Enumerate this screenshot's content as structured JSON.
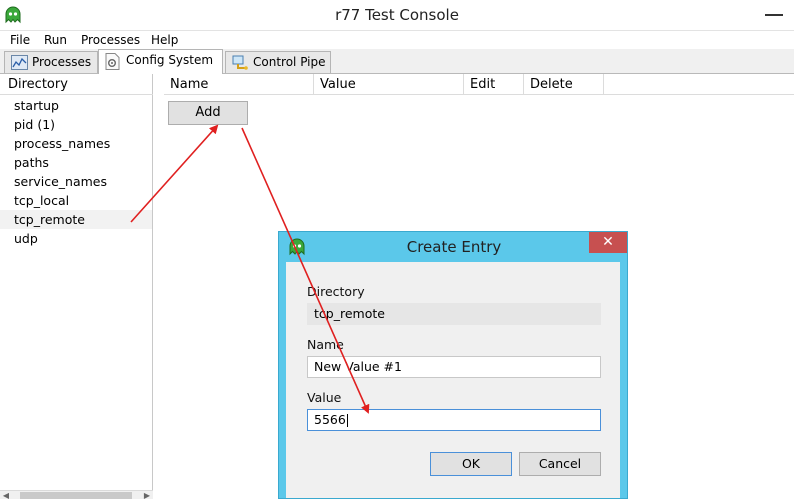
{
  "window": {
    "title": "r77 Test Console"
  },
  "menu": [
    "File",
    "Run",
    "Processes",
    "Help"
  ],
  "tabs": [
    {
      "label": "Processes",
      "icon": "chart-icon"
    },
    {
      "label": "Config System",
      "icon": "gear-document-icon",
      "active": true
    },
    {
      "label": "Control Pipe",
      "icon": "network-pipe-icon"
    }
  ],
  "directory": {
    "header": "Directory",
    "items": [
      "startup",
      "pid (1)",
      "process_names",
      "paths",
      "service_names",
      "tcp_local",
      "tcp_remote",
      "udp"
    ],
    "selected": "tcp_remote"
  },
  "grid": {
    "columns": [
      "Name",
      "Value",
      "Edit",
      "Delete"
    ],
    "add_label": "Add"
  },
  "dialog": {
    "title": "Create Entry",
    "directory_label": "Directory",
    "directory_value": "tcp_remote",
    "name_label": "Name",
    "name_value": "New Value #1",
    "value_label": "Value",
    "value_value": "5566",
    "ok_label": "OK",
    "cancel_label": "Cancel"
  },
  "colors": {
    "dialog_frame": "#5bc8ea",
    "close_button": "#c75050",
    "annotation_arrow": "#e02020",
    "app_icon": "#3aa83a"
  }
}
